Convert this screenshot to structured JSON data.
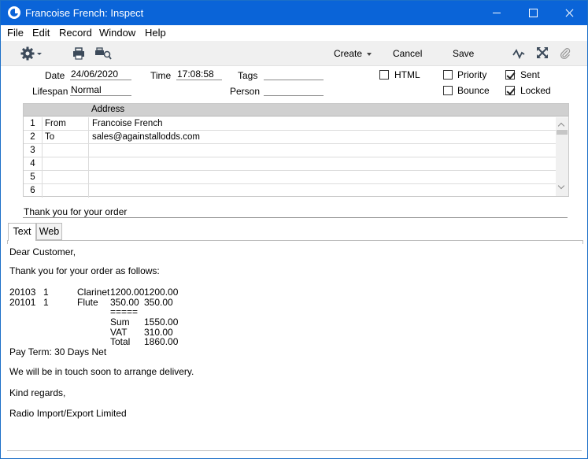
{
  "window": {
    "title": "Francoise French: Inspect"
  },
  "menu": [
    "File",
    "Edit",
    "Record",
    "Window",
    "Help"
  ],
  "toolbar": {
    "create_label": "Create",
    "cancel_label": "Cancel",
    "save_label": "Save"
  },
  "header": {
    "date_label": "Date",
    "date_value": "24/06/2020",
    "time_label": "Time",
    "time_value": "17:08:58",
    "tags_label": "Tags",
    "tags_value": "",
    "lifespan_label": "Lifespan",
    "lifespan_value": "Normal",
    "person_label": "Person",
    "person_value": "",
    "html_label": "HTML",
    "html_checked": false,
    "priority_label": "Priority",
    "priority_checked": false,
    "sent_label": "Sent",
    "sent_checked": true,
    "bounce_label": "Bounce",
    "bounce_checked": false,
    "locked_label": "Locked",
    "locked_checked": true
  },
  "grid": {
    "column_header": "Address",
    "rows": [
      {
        "num": "1",
        "role": "From",
        "address": "Francoise French"
      },
      {
        "num": "2",
        "role": "To",
        "address": "sales@againstallodds.com"
      },
      {
        "num": "3",
        "role": "",
        "address": ""
      },
      {
        "num": "4",
        "role": "",
        "address": ""
      },
      {
        "num": "5",
        "role": "",
        "address": ""
      },
      {
        "num": "6",
        "role": "",
        "address": ""
      }
    ]
  },
  "subject": "Thank you for your order",
  "tabs": [
    "Text",
    "Web"
  ],
  "body": {
    "greeting": "Dear Customer,",
    "intro": "Thank you for your order as follows:",
    "lines": [
      {
        "code": "20103",
        "qty": "1",
        "item": "Clarinet",
        "price": "1200.00",
        "total": "1200.00"
      },
      {
        "code": "20101",
        "qty": "1",
        "item": "Flute",
        "price": "350.00",
        "total": "350.00"
      }
    ],
    "separator": "=====",
    "sum_label": "Sum",
    "sum_value": "1550.00",
    "vat_label": "VAT",
    "vat_value": "310.00",
    "total_label": "Total",
    "total_value": "1860.00",
    "pay_term": "Pay Term: 30 Days Net",
    "delivery": "We will be in touch soon to arrange delivery.",
    "regards": "Kind regards,",
    "company": "Radio Import/Export Limited"
  }
}
